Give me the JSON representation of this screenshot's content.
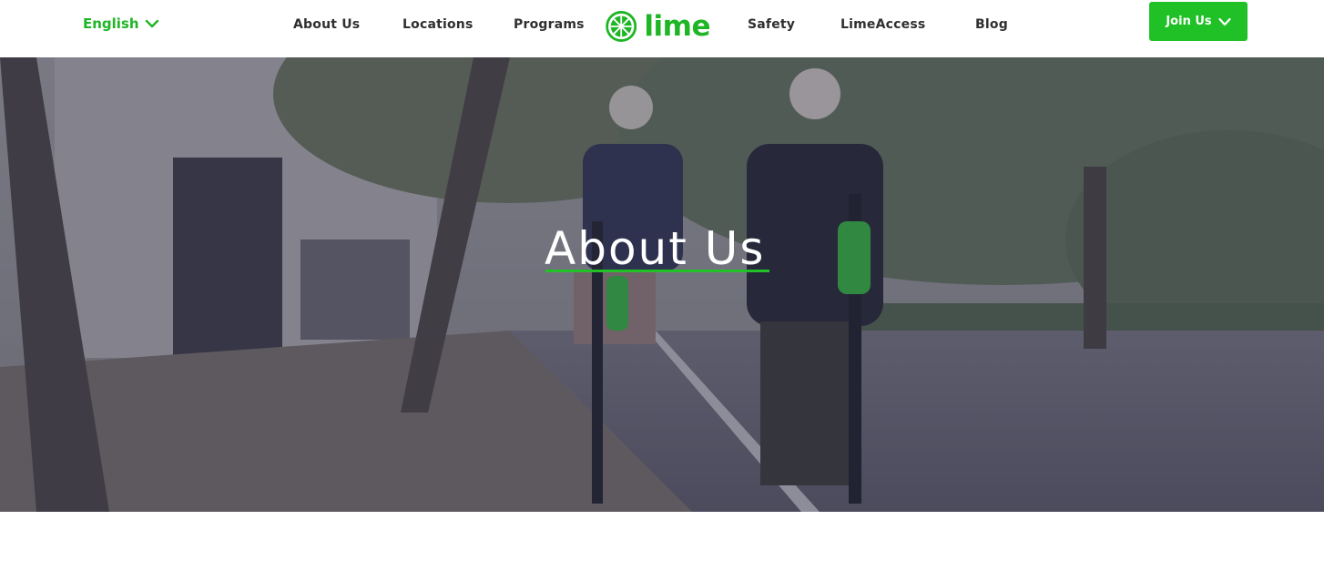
{
  "header": {
    "language": {
      "label": "English",
      "icon": "chevron-down-icon"
    },
    "nav": [
      {
        "label": "About Us"
      },
      {
        "label": "Locations"
      },
      {
        "label": "Programs"
      },
      {
        "label": "Safety"
      },
      {
        "label": "LimeAccess"
      },
      {
        "label": "Blog"
      }
    ],
    "logo": {
      "text": "lime",
      "icon": "lime-wheel-icon"
    },
    "join_button": {
      "label": "Join Us",
      "icon": "chevron-down-icon"
    }
  },
  "hero": {
    "title": "About Us",
    "image": "photo of two people riding Lime-S electric scooters down a tree-lined street"
  },
  "colors": {
    "brand_green": "#1fb626",
    "button_green": "#1fc126",
    "nav_text": "#2f2f2f",
    "hero_text": "#ffffff"
  }
}
